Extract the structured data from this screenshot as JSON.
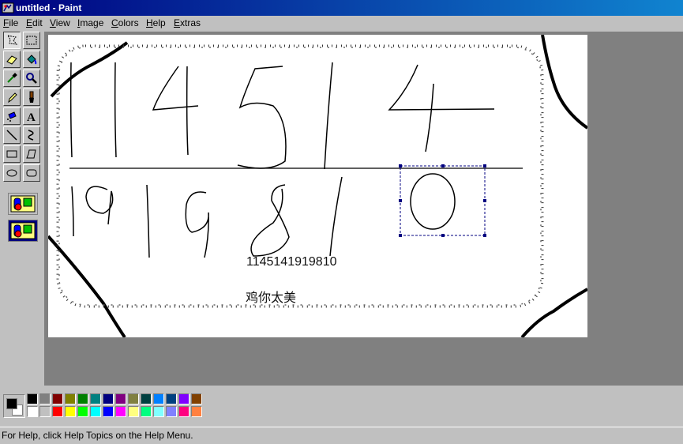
{
  "window": {
    "title": "untitled - Paint"
  },
  "menu": [
    {
      "accel": "F",
      "rest": "ile"
    },
    {
      "accel": "E",
      "rest": "dit"
    },
    {
      "accel": "V",
      "rest": "iew"
    },
    {
      "accel": "I",
      "rest": "mage"
    },
    {
      "accel": "C",
      "rest": "olors"
    },
    {
      "accel": "H",
      "rest": "elp"
    },
    {
      "accel": "E",
      "rest": "xtras"
    }
  ],
  "tools": [
    {
      "name": "free-form-select-icon",
      "pressed": true
    },
    {
      "name": "select-icon",
      "pressed": false
    },
    {
      "name": "eraser-icon",
      "pressed": false
    },
    {
      "name": "fill-with-color-icon",
      "pressed": false
    },
    {
      "name": "pick-color-icon",
      "pressed": false
    },
    {
      "name": "magnifier-icon",
      "pressed": false
    },
    {
      "name": "pencil-icon",
      "pressed": false
    },
    {
      "name": "brush-icon",
      "pressed": false
    },
    {
      "name": "airbrush-icon",
      "pressed": false
    },
    {
      "name": "text-icon",
      "pressed": false
    },
    {
      "name": "line-icon",
      "pressed": false
    },
    {
      "name": "curve-icon",
      "pressed": false
    },
    {
      "name": "rectangle-icon",
      "pressed": false
    },
    {
      "name": "polygon-icon",
      "pressed": false
    },
    {
      "name": "ellipse-icon",
      "pressed": false
    },
    {
      "name": "rounded-rectangle-icon",
      "pressed": false
    }
  ],
  "canvas": {
    "digits_row1": "114514",
    "digits_row2": "1919810",
    "typed_number": "1145141919810",
    "typed_caption": "鸡你太美"
  },
  "colors": {
    "foreground": "#000000",
    "background": "#ffffff",
    "palette_row1": [
      "#000000",
      "#808080",
      "#800000",
      "#808000",
      "#008000",
      "#008080",
      "#000080",
      "#800080",
      "#808040",
      "#004040",
      "#0080ff",
      "#004080",
      "#8000ff",
      "#804000"
    ],
    "palette_row2": [
      "#ffffff",
      "#c0c0c0",
      "#ff0000",
      "#ffff00",
      "#00ff00",
      "#00ffff",
      "#0000ff",
      "#ff00ff",
      "#ffff80",
      "#00ff80",
      "#80ffff",
      "#8080ff",
      "#ff0080",
      "#ff8040"
    ]
  },
  "status": {
    "text": "For Help, click Help Topics on the Help Menu."
  }
}
